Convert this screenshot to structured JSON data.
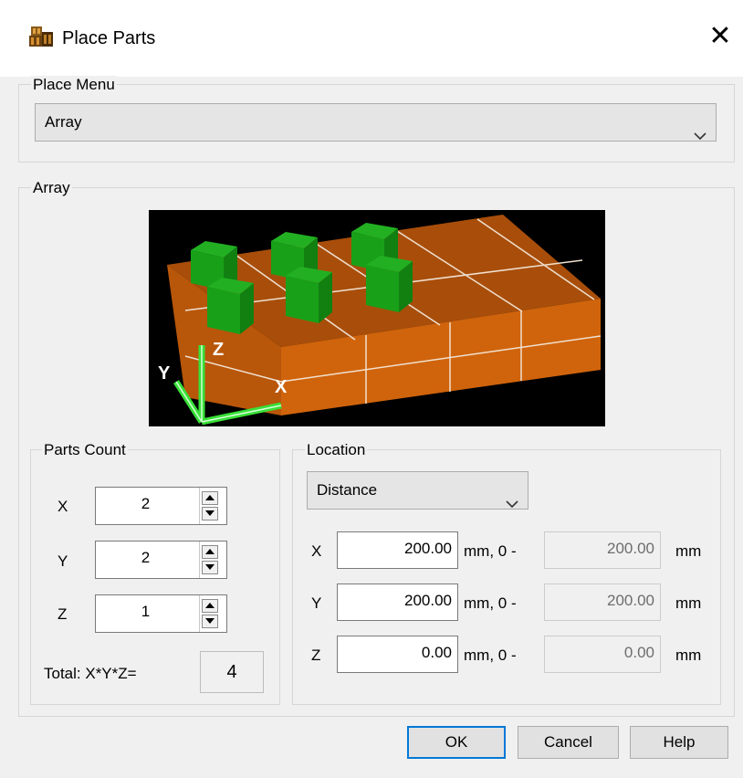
{
  "window": {
    "title": "Place Parts",
    "close_glyph": "✕"
  },
  "place_menu": {
    "legend": "Place Menu",
    "selected": "Array"
  },
  "array_group": {
    "legend": "Array",
    "preview": {
      "axis_labels": {
        "x": "X",
        "y": "Y",
        "z": "Z"
      },
      "colors": {
        "block": "#d0640c",
        "part": "#19a019",
        "axis": "#38e038",
        "background": "#000000"
      }
    }
  },
  "parts_count": {
    "legend": "Parts Count",
    "rows": [
      {
        "axis": "X",
        "value": "2"
      },
      {
        "axis": "Y",
        "value": "2"
      },
      {
        "axis": "Z",
        "value": "1"
      }
    ],
    "total_label": "Total: X*Y*Z=",
    "total_value": "4"
  },
  "location": {
    "legend": "Location",
    "mode": "Distance",
    "rows": [
      {
        "axis": "X",
        "value": "200.00",
        "unit_mid": "mm, 0 -",
        "max": "200.00",
        "unit": "mm"
      },
      {
        "axis": "Y",
        "value": "200.00",
        "unit_mid": "mm, 0 -",
        "max": "200.00",
        "unit": "mm"
      },
      {
        "axis": "Z",
        "value": "0.00",
        "unit_mid": "mm, 0 -",
        "max": "0.00",
        "unit": "mm"
      }
    ]
  },
  "buttons": {
    "ok": "OK",
    "cancel": "Cancel",
    "help": "Help"
  }
}
